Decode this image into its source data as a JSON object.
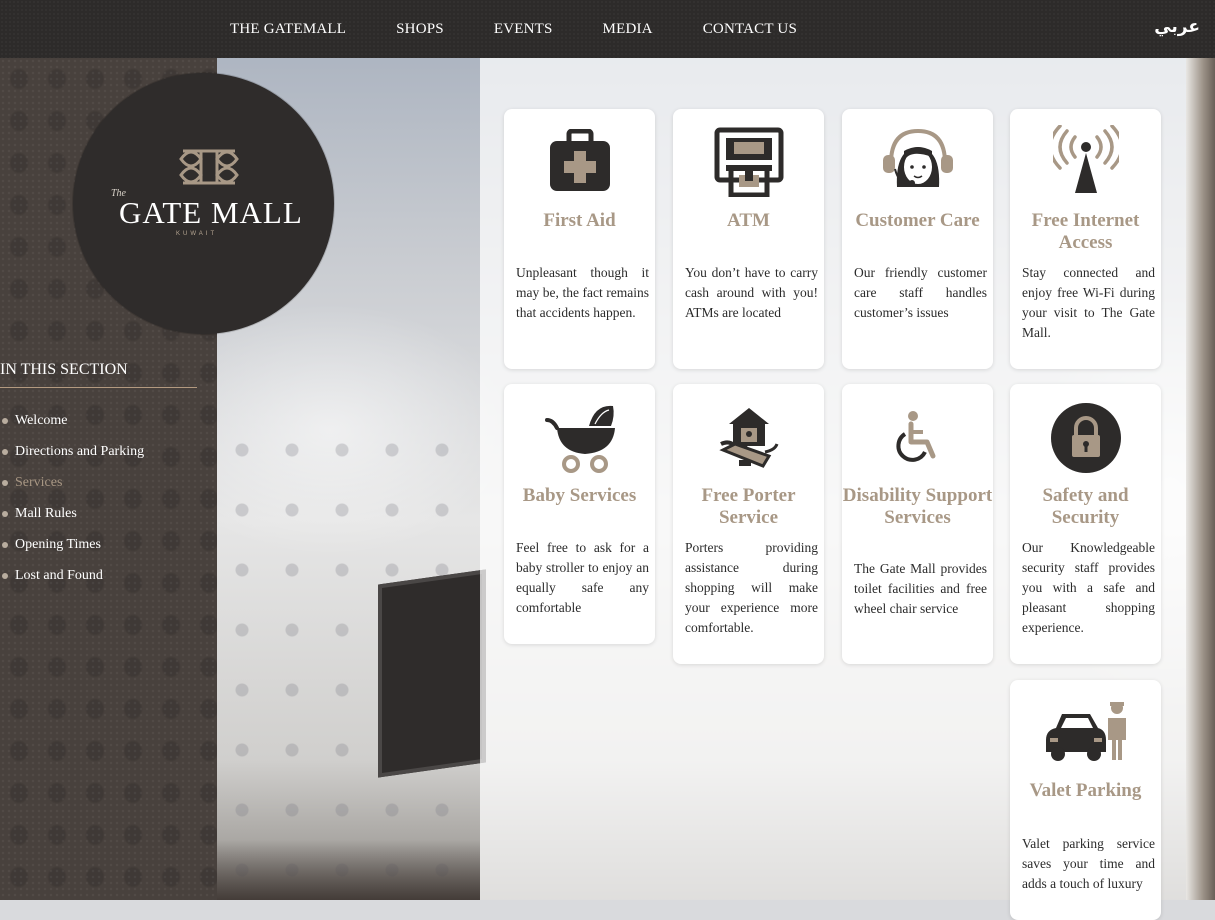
{
  "nav": {
    "items": [
      "THE GATEMALL",
      "SHOPS",
      "EVENTS",
      "MEDIA",
      "CONTACT US"
    ],
    "language": "عربي"
  },
  "logo": {
    "the": "The",
    "name": "GATE MALL",
    "sub": "KUWAIT"
  },
  "sidebar": {
    "title": "IN THIS SECTION",
    "items": [
      {
        "label": "Welcome"
      },
      {
        "label": "Directions and Parking"
      },
      {
        "label": "Services"
      },
      {
        "label": "Mall Rules"
      },
      {
        "label": "Opening Times"
      },
      {
        "label": "Lost and Found"
      }
    ],
    "active": "Services"
  },
  "services": [
    {
      "icon": "first-aid-kit-icon",
      "title": "First Aid",
      "desc": "Unpleasant though it may be, the fact remains that accidents happen."
    },
    {
      "icon": "atm-icon",
      "title": "ATM",
      "desc": "You don’t have to carry cash around with you! ATMs are located"
    },
    {
      "icon": "customer-care-icon",
      "title": "Customer Care",
      "desc": "Our friendly customer care staff handles customer’s issues"
    },
    {
      "icon": "wifi-antenna-icon",
      "title": "Free Internet Access",
      "desc": "Stay connected and enjoy free Wi-Fi during your visit to The Gate Mall."
    },
    {
      "icon": "baby-stroller-icon",
      "title": "Baby Services",
      "desc": "Feel free to ask for a baby stroller to enjoy an equally safe any comfortable"
    },
    {
      "icon": "porter-icon",
      "title": "Free Porter Service",
      "desc": "Porters providing assistance during shopping will make your experience more comfortable."
    },
    {
      "icon": "wheelchair-icon",
      "title": "Disability Support Services",
      "desc": "The Gate Mall provides toilet facilities and free wheel chair service"
    },
    {
      "icon": "padlock-icon",
      "title": "Safety and Security",
      "desc": "Our Knowledgeable security staff provides you with a safe and pleasant shopping experience."
    },
    {
      "icon": "valet-parking-icon",
      "title": "Valet Parking",
      "desc": "Valet parking service saves your time and adds a touch of luxury"
    }
  ],
  "colors": {
    "accent": "#a89886",
    "dark": "#2d2b2a",
    "sidebar": "#48413d"
  }
}
